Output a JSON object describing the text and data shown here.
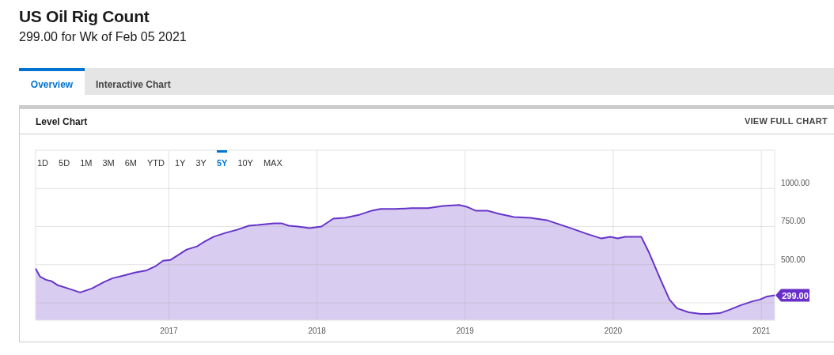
{
  "title": "US Oil Rig Count",
  "subtitle": "299.00 for Wk of Feb 05 2021",
  "tabs": [
    {
      "label": "Overview",
      "selected": true
    },
    {
      "label": "Interactive Chart",
      "selected": false
    }
  ],
  "card": {
    "title": "Level Chart",
    "link": "VIEW FULL CHART",
    "ranges": [
      {
        "label": "1D",
        "selected": false
      },
      {
        "label": "5D",
        "selected": false
      },
      {
        "label": "1M",
        "selected": false
      },
      {
        "label": "3M",
        "selected": false
      },
      {
        "label": "6M",
        "selected": false
      },
      {
        "label": "YTD",
        "selected": false
      },
      {
        "label": "1Y",
        "selected": false
      },
      {
        "label": "3Y",
        "selected": false
      },
      {
        "label": "5Y",
        "selected": true
      },
      {
        "label": "10Y",
        "selected": false
      },
      {
        "label": "MAX",
        "selected": false
      }
    ],
    "current_value_label": "299.00",
    "chart_data": {
      "type": "area",
      "grid": true,
      "xlim": [
        2016.1,
        2021.09
      ],
      "ylim": [
        136,
        1250
      ],
      "xticks": [
        2017,
        2018,
        2019,
        2020,
        2021
      ],
      "yticks": [
        {
          "value": 500,
          "label": "500.00"
        },
        {
          "value": 750,
          "label": "750.00"
        },
        {
          "value": 1000,
          "label": "1000.00"
        }
      ],
      "x": [
        2016.1,
        2016.13,
        2016.17,
        2016.21,
        2016.25,
        2016.32,
        2016.4,
        2016.48,
        2016.56,
        2016.62,
        2016.69,
        2016.77,
        2016.85,
        2016.91,
        2016.96,
        2017.01,
        2017.07,
        2017.12,
        2017.19,
        2017.24,
        2017.3,
        2017.38,
        2017.46,
        2017.54,
        2017.6,
        2017.71,
        2017.76,
        2017.81,
        2017.87,
        2017.95,
        2018.03,
        2018.11,
        2018.19,
        2018.29,
        2018.37,
        2018.43,
        2018.53,
        2018.64,
        2018.75,
        2018.85,
        2018.96,
        2019.01,
        2019.07,
        2019.15,
        2019.23,
        2019.28,
        2019.33,
        2019.44,
        2019.55,
        2019.63,
        2019.71,
        2019.82,
        2019.92,
        2019.98,
        2020.03,
        2020.08,
        2020.19,
        2020.24,
        2020.32,
        2020.38,
        2020.43,
        2020.51,
        2020.59,
        2020.64,
        2020.72,
        2020.78,
        2020.86,
        2020.94,
        2020.99,
        2021.04,
        2021.09
      ],
      "series": [
        {
          "color": "#6634c8",
          "values": [
            474,
            422,
            401,
            391,
            365,
            344,
            318,
            344,
            385,
            411,
            427,
            448,
            463,
            490,
            526,
            531,
            568,
            599,
            620,
            651,
            682,
            708,
            729,
            755,
            760,
            771,
            771,
            755,
            750,
            740,
            750,
            802,
            807,
            828,
            854,
            865,
            865,
            870,
            870,
            885,
            891,
            880,
            854,
            854,
            833,
            823,
            812,
            807,
            792,
            766,
            740,
            703,
            672,
            682,
            672,
            682,
            682,
            583,
            401,
            271,
            214,
            188,
            177,
            177,
            182,
            203,
            234,
            260,
            271,
            292,
            299
          ]
        }
      ]
    }
  }
}
